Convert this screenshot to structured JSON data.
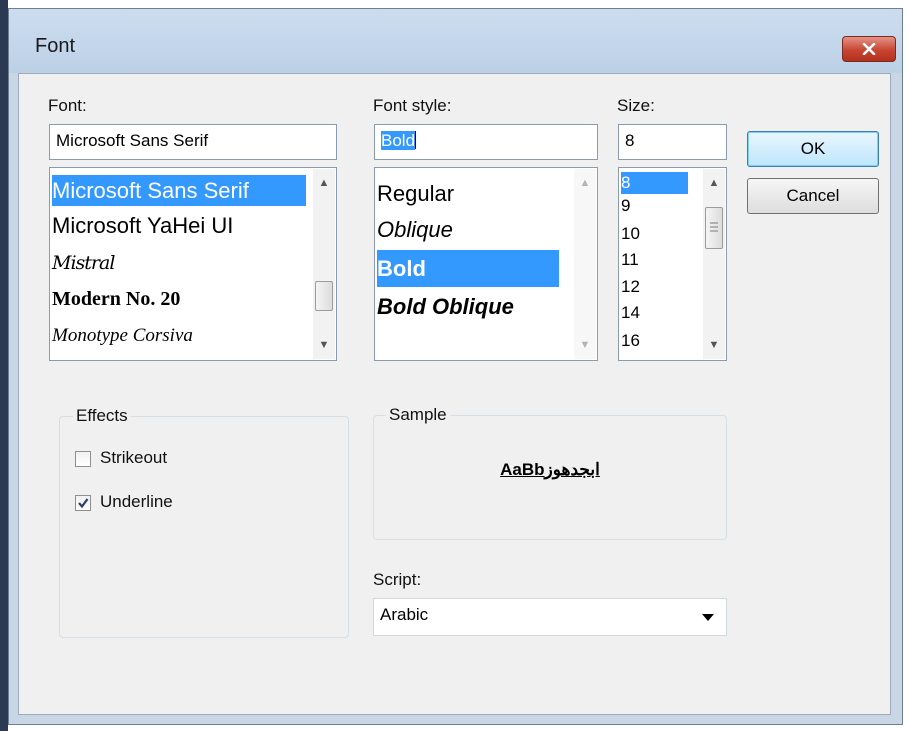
{
  "dialog": {
    "title": "Font"
  },
  "font": {
    "label": "Font:",
    "value": "Microsoft Sans Serif",
    "items": [
      "Microsoft Sans Serif",
      "Microsoft YaHei UI",
      "Mistral",
      "Modern No. 20",
      "Monotype Corsiva"
    ],
    "selected": "Microsoft Sans Serif"
  },
  "style": {
    "label": "Font style:",
    "value": "Bold",
    "items": [
      "Regular",
      "Oblique",
      "Bold",
      "Bold Oblique"
    ],
    "selected": "Bold"
  },
  "size": {
    "label": "Size:",
    "value": "8",
    "items": [
      "8",
      "9",
      "10",
      "11",
      "12",
      "14",
      "16"
    ],
    "selected": "8"
  },
  "buttons": {
    "ok": "OK",
    "cancel": "Cancel"
  },
  "effects": {
    "title": "Effects",
    "strikeout": {
      "label": "Strikeout",
      "checked": false
    },
    "underline": {
      "label": "Underline",
      "checked": true
    }
  },
  "sample": {
    "title": "Sample",
    "text": "AaBbابجدهوز"
  },
  "script": {
    "label": "Script:",
    "value": "Arabic"
  },
  "colors": {
    "selection": "#3399ff",
    "close_button": "#c74531"
  },
  "icons": {
    "close": "close-icon",
    "up": "chevron-up-icon",
    "down": "chevron-down-icon",
    "check": "checkmark-icon",
    "dropdown": "dropdown-arrow-icon"
  }
}
